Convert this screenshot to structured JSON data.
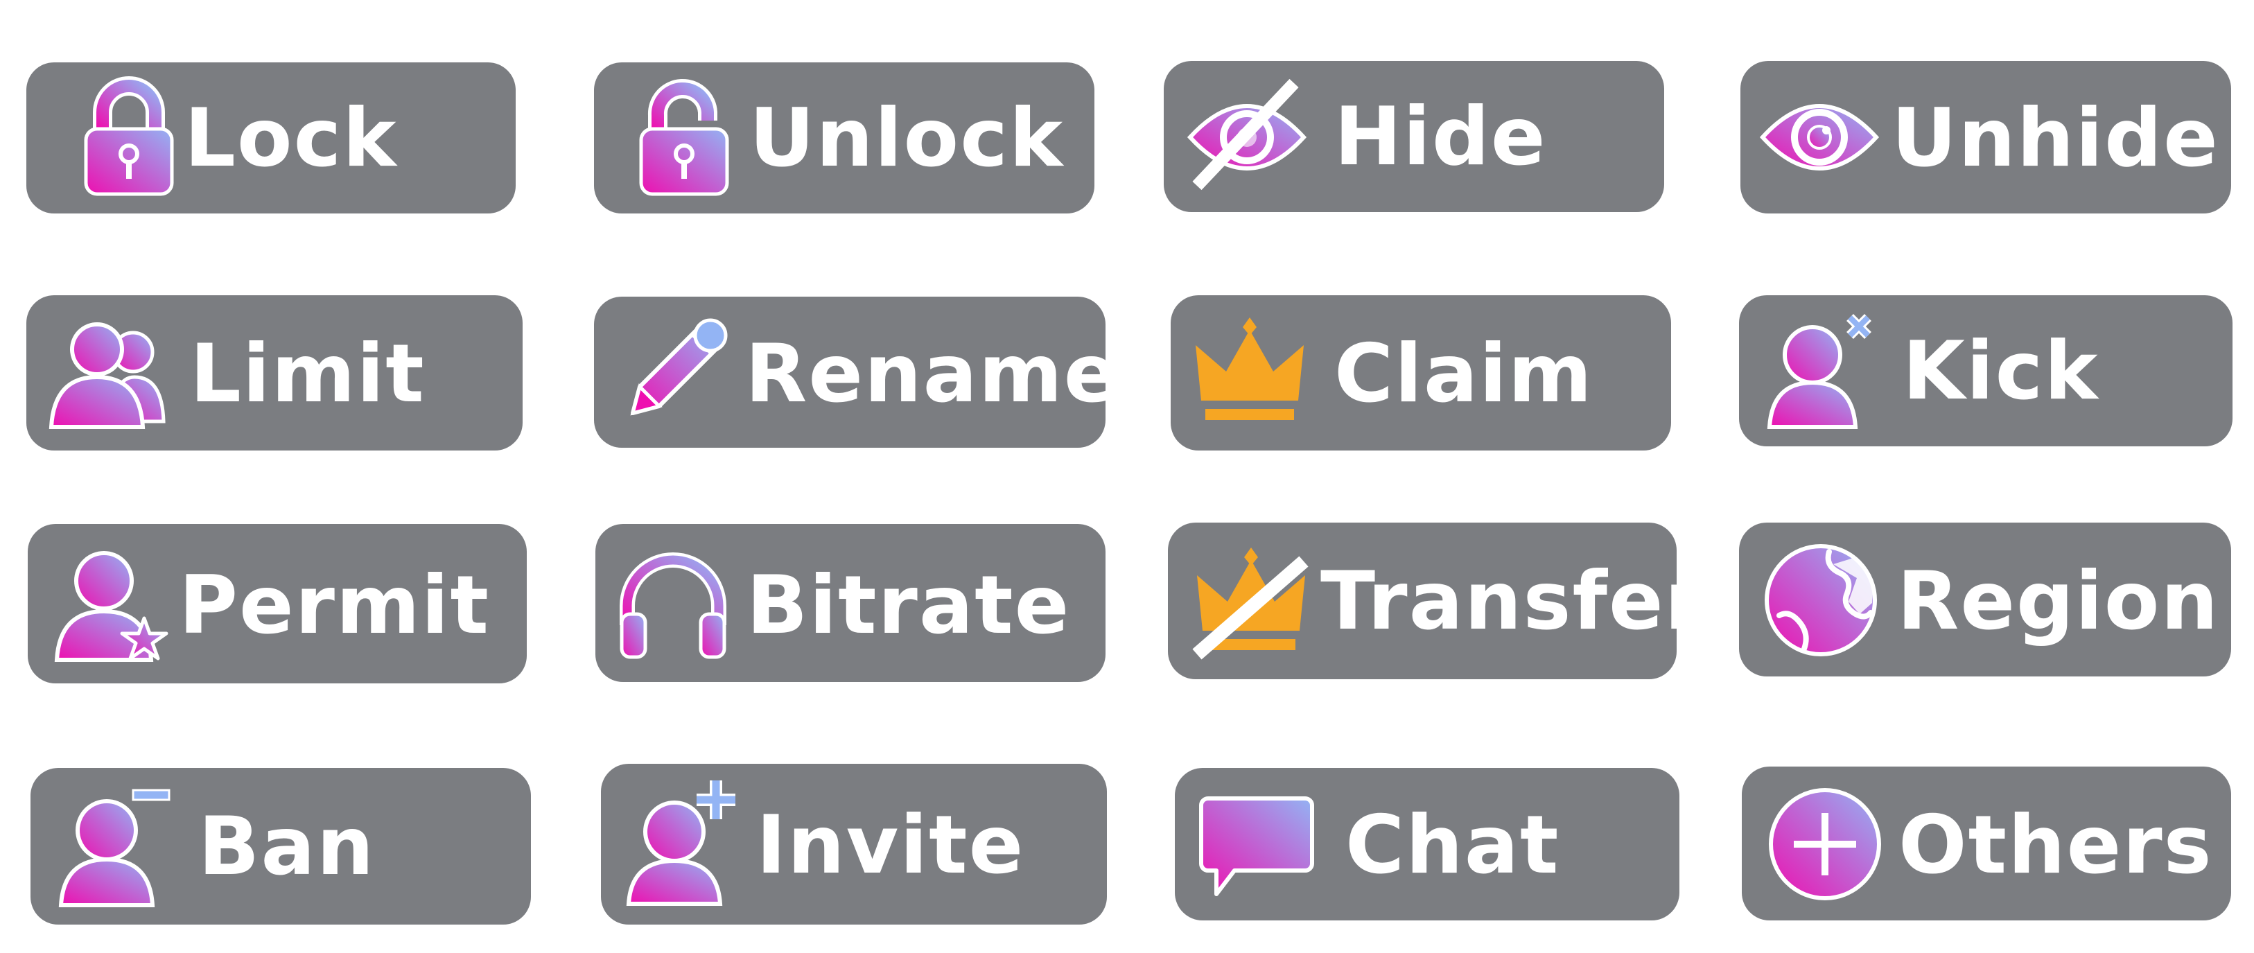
{
  "panel": {
    "background": "#ffffff",
    "button_color": "#7b7d81",
    "label_color": "#ffffff",
    "icon_gradient": [
      "#ee16b6",
      "#8fa9f2"
    ],
    "crown_color": "#f6a623"
  },
  "buttons": [
    {
      "id": "lock",
      "label": "Lock",
      "icon": "padlock-closed-icon"
    },
    {
      "id": "unlock",
      "label": "Unlock",
      "icon": "padlock-open-icon"
    },
    {
      "id": "hide",
      "label": "Hide",
      "icon": "eye-slash-icon"
    },
    {
      "id": "unhide",
      "label": "Unhide",
      "icon": "eye-icon"
    },
    {
      "id": "limit",
      "label": "Limit",
      "icon": "users-icon"
    },
    {
      "id": "rename",
      "label": "Rename",
      "icon": "pencil-icon"
    },
    {
      "id": "claim",
      "label": "Claim",
      "icon": "crown-icon"
    },
    {
      "id": "kick",
      "label": "Kick",
      "icon": "user-x-icon"
    },
    {
      "id": "permit",
      "label": "Permit",
      "icon": "user-star-icon"
    },
    {
      "id": "bitrate",
      "label": "Bitrate",
      "icon": "headphones-icon"
    },
    {
      "id": "transfer",
      "label": "Transfer",
      "icon": "crown-slash-icon"
    },
    {
      "id": "region",
      "label": "Region",
      "icon": "globe-icon"
    },
    {
      "id": "ban",
      "label": "Ban",
      "icon": "user-minus-icon"
    },
    {
      "id": "invite",
      "label": "Invite",
      "icon": "user-plus-icon"
    },
    {
      "id": "chat",
      "label": "Chat",
      "icon": "chat-bubble-icon"
    },
    {
      "id": "others",
      "label": "Others",
      "icon": "plus-circle-icon"
    }
  ]
}
